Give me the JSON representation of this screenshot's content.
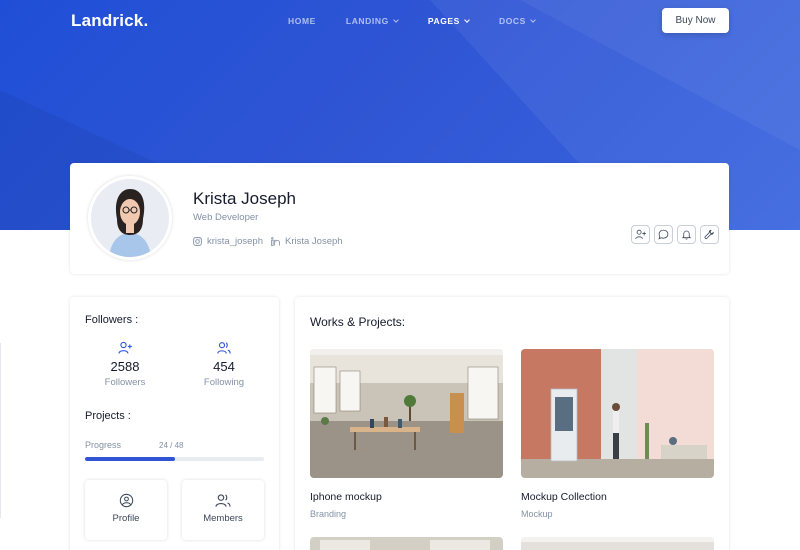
{
  "brand": {
    "logo": "Landrick."
  },
  "nav": {
    "items": [
      {
        "label": "HOME",
        "has_dropdown": false,
        "active": false
      },
      {
        "label": "LANDING",
        "has_dropdown": true,
        "active": false
      },
      {
        "label": "PAGES",
        "has_dropdown": true,
        "active": true
      },
      {
        "label": "DOCS",
        "has_dropdown": true,
        "active": false
      }
    ],
    "cta_label": "Buy Now"
  },
  "profile": {
    "name": "Krista Joseph",
    "role": "Web Developer",
    "instagram": "krista_joseph",
    "linkedin": "Krista Joseph",
    "actions": [
      "user-plus-icon",
      "message-icon",
      "bell-icon",
      "tool-icon"
    ]
  },
  "sidebar": {
    "followers_title": "Followers :",
    "stats": [
      {
        "value": "2588",
        "label": "Followers",
        "icon": "user-plus-icon"
      },
      {
        "value": "454",
        "label": "Following",
        "icon": "users-icon"
      }
    ],
    "projects_title": "Projects :",
    "progress": {
      "label": "Progress",
      "value_text": "24 / 48",
      "fraction": 0.5
    },
    "tiles": [
      {
        "label": "Profile",
        "icon": "profile-icon"
      },
      {
        "label": "Members",
        "icon": "users-icon"
      }
    ]
  },
  "works": {
    "title": "Works & Projects:",
    "items": [
      {
        "name": "Iphone mockup",
        "category": "Branding"
      },
      {
        "name": "Mockup Collection",
        "category": "Mockup"
      }
    ]
  },
  "colors": {
    "primary": "#2f55d4",
    "heading": "#161c2d",
    "muted": "#8492a6"
  }
}
